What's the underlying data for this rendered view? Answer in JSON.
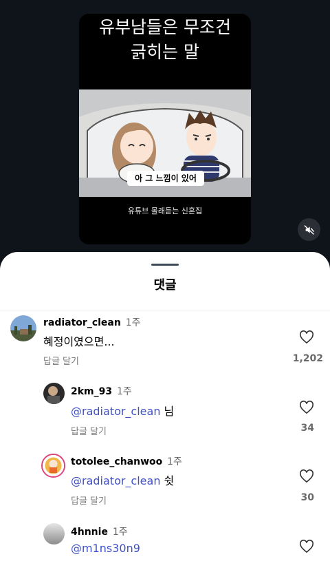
{
  "video": {
    "title_line1": "유부남들은 무조건",
    "title_line2": "긁히는 말",
    "subtitle": "아 그 느낌이 있어",
    "caption": "유튜브 몰래듣는 신혼집"
  },
  "sheet": {
    "title": "댓글"
  },
  "comments": [
    {
      "username": "radiator_clean",
      "time": "1주",
      "mention": "",
      "text": "혜정이였으면...",
      "reply_label": "답글 달기",
      "likes": "1,202"
    },
    {
      "username": "2km_93",
      "time": "1주",
      "mention": "@radiator_clean",
      "text": " 님",
      "reply_label": "답글 달기",
      "likes": "34"
    },
    {
      "username": "totolee_chanwoo",
      "time": "1주",
      "mention": "@radiator_clean",
      "text": " 쉿",
      "reply_label": "답글 달기",
      "likes": "30"
    },
    {
      "username": "4hnnie",
      "time": "1주",
      "mention": "@m1ns30n9",
      "text": "",
      "reply_label": "",
      "likes": ""
    }
  ],
  "icons": {
    "mute": "speaker-muted-icon",
    "like": "heart-outline-icon"
  },
  "colors": {
    "background": "#0f131a",
    "mention": "#3f51c9",
    "sheet": "#ffffff"
  }
}
